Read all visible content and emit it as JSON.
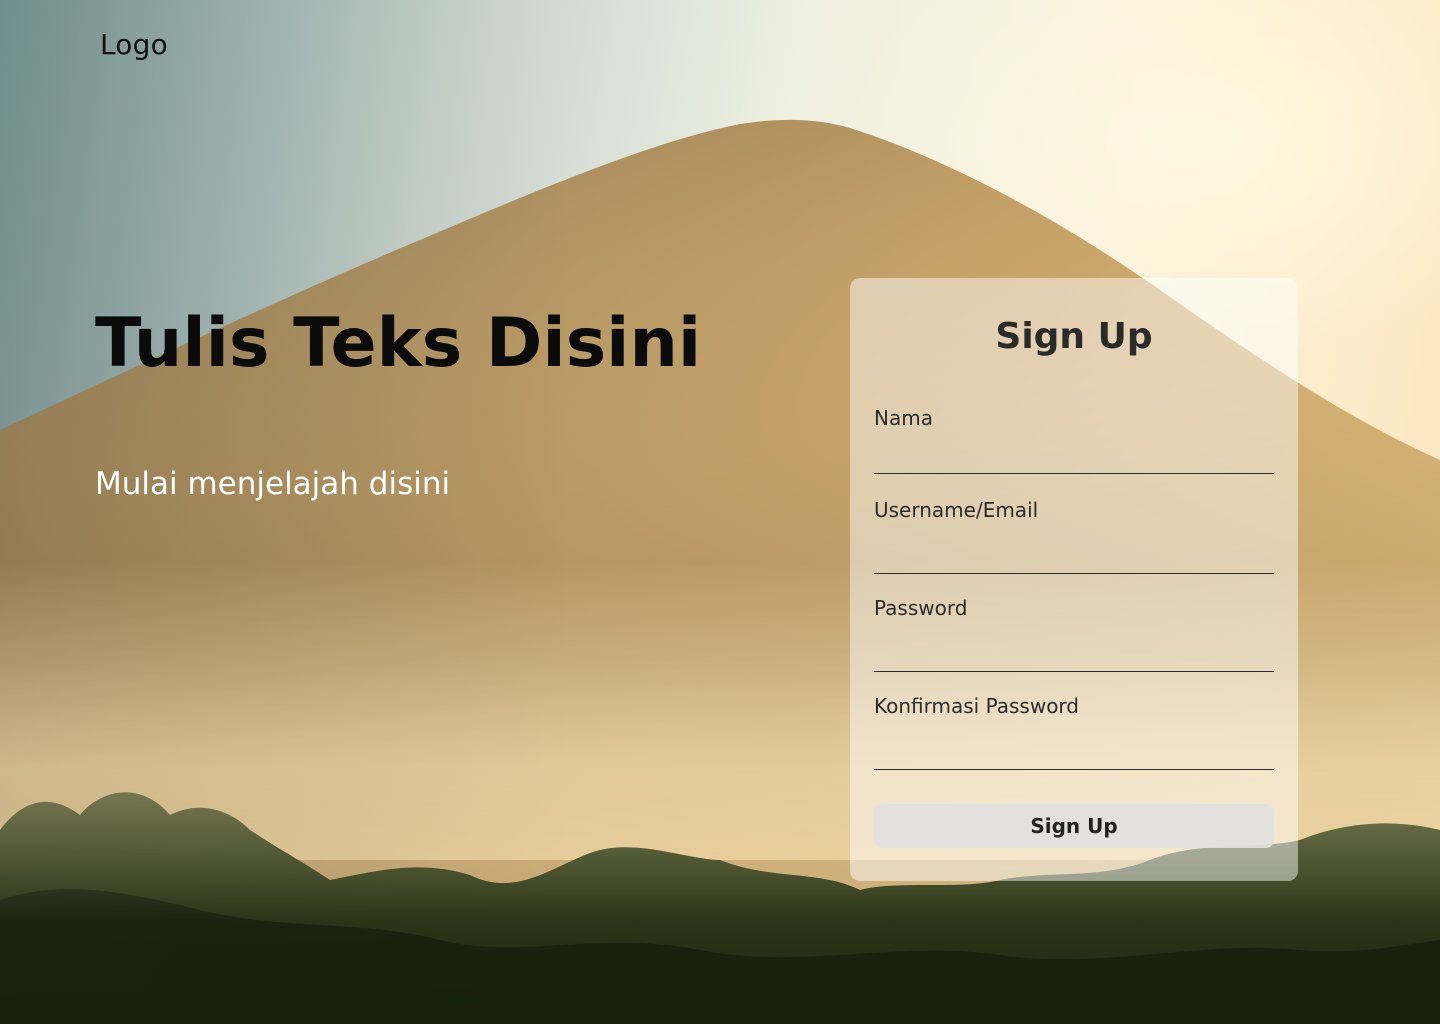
{
  "header": {
    "logo_text": "Logo"
  },
  "hero": {
    "title": "Tulis Teks Disini",
    "subtitle": "Mulai menjelajah disini"
  },
  "signup": {
    "title": "Sign Up",
    "fields": [
      {
        "label": "Nama",
        "value": "",
        "placeholder": ""
      },
      {
        "label": "Username/Email",
        "value": "",
        "placeholder": ""
      },
      {
        "label": "Password",
        "value": "",
        "placeholder": ""
      },
      {
        "label": "Konfirmasi Password",
        "value": "",
        "placeholder": ""
      }
    ],
    "submit_label": "Sign Up"
  },
  "colors": {
    "title_text": "#0b0b0b",
    "subtitle_text": "#ffffff",
    "card_background": "rgba(255,255,255,0.48)",
    "button_background": "#e1e1e1"
  },
  "icons": {
    "background": "mountain-landscape-photo"
  }
}
